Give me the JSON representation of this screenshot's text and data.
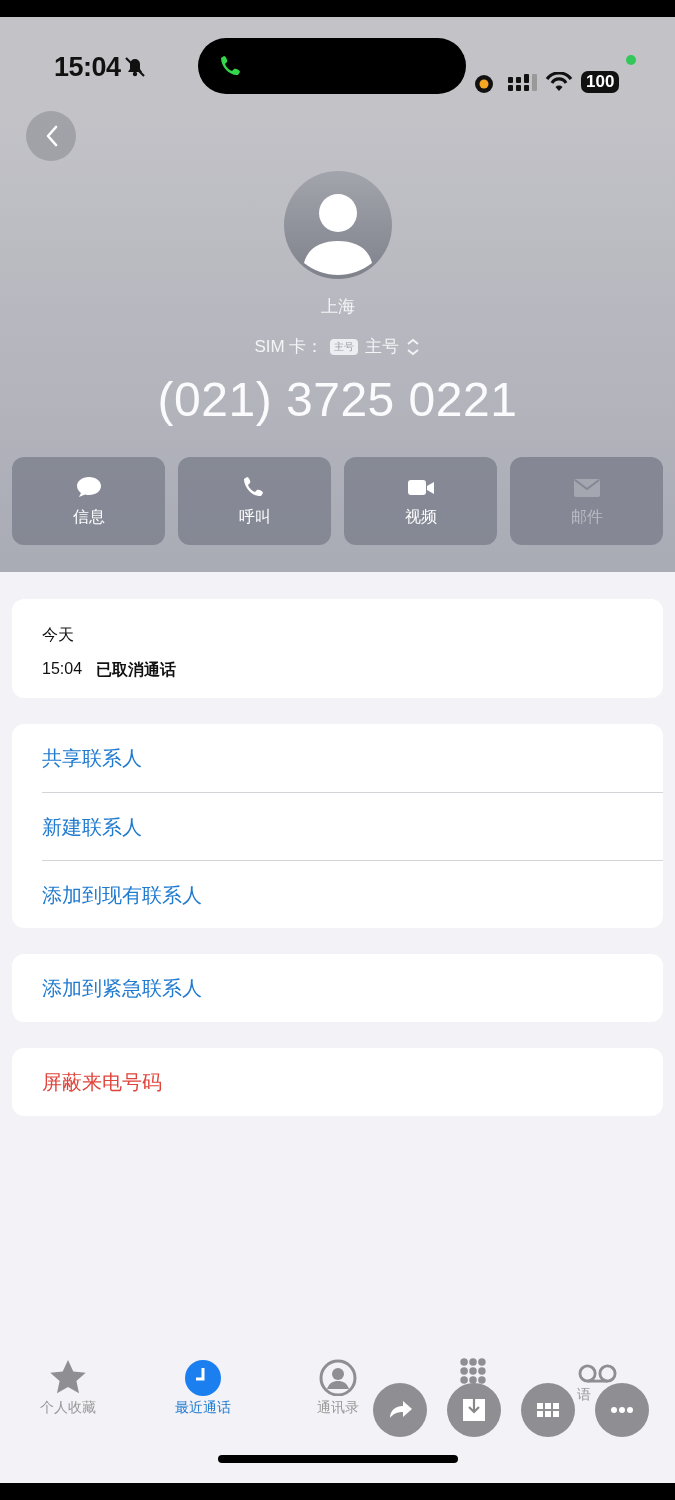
{
  "status_bar": {
    "time": "15:04",
    "silent": true,
    "battery": "100"
  },
  "contact": {
    "location": "上海",
    "sim_label": "SIM 卡：",
    "sim_badge": "主号",
    "sim_line": "主号",
    "number": "(021) 3725 0221"
  },
  "actions": [
    {
      "kind": "message",
      "label": "信息",
      "disabled": false
    },
    {
      "kind": "call",
      "label": "呼叫",
      "disabled": false
    },
    {
      "kind": "video",
      "label": "视频",
      "disabled": false
    },
    {
      "kind": "mail",
      "label": "邮件",
      "disabled": true
    }
  ],
  "recent": {
    "day": "今天",
    "calls": [
      {
        "time": "15:04",
        "status": "已取消通话"
      }
    ]
  },
  "groups": [
    {
      "items": [
        {
          "label": "共享联系人",
          "kind": "link"
        },
        {
          "label": "新建联系人",
          "kind": "link"
        },
        {
          "label": "添加到现有联系人",
          "kind": "link"
        }
      ]
    },
    {
      "items": [
        {
          "label": "添加到紧急联系人",
          "kind": "link"
        }
      ]
    },
    {
      "items": [
        {
          "label": "屏蔽来电号码",
          "kind": "destructive"
        }
      ]
    }
  ],
  "tabs": [
    {
      "kind": "favorites",
      "label": "个人收藏",
      "selected": false
    },
    {
      "kind": "recents",
      "label": "最近通话",
      "selected": true
    },
    {
      "kind": "contacts",
      "label": "通讯录",
      "selected": false
    },
    {
      "kind": "keypad",
      "selected": false
    },
    {
      "kind": "voicemail",
      "label": "语",
      "selected": false
    }
  ],
  "viewer_controls": [
    {
      "kind": "share"
    },
    {
      "kind": "save"
    },
    {
      "kind": "grid"
    },
    {
      "kind": "more"
    }
  ]
}
